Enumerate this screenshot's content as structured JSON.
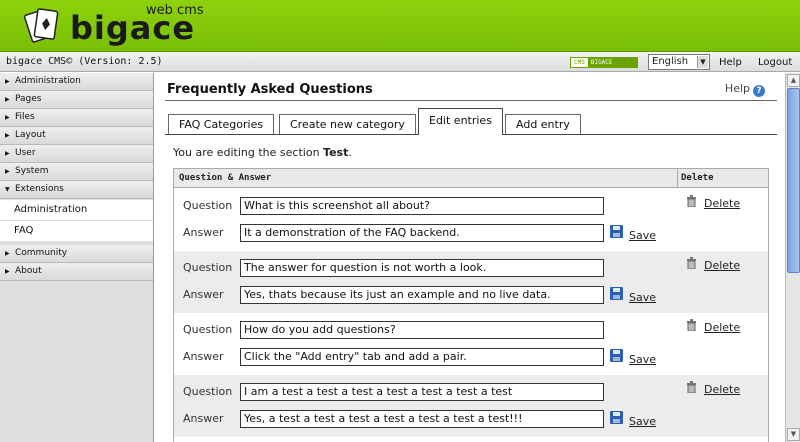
{
  "header": {
    "logo_text": "bigace",
    "logo_sub": "web cms"
  },
  "toolbar": {
    "version": "bigace CMS© (Version: 2.5)",
    "badge_left": "CMS",
    "badge_right": "BIGACE",
    "language": "English",
    "help": "Help",
    "logout": "Logout"
  },
  "sidebar": {
    "items": [
      {
        "label": "Administration"
      },
      {
        "label": "Pages"
      },
      {
        "label": "Files"
      },
      {
        "label": "Layout"
      },
      {
        "label": "User"
      },
      {
        "label": "System"
      },
      {
        "label": "Extensions"
      },
      {
        "label": "Community"
      },
      {
        "label": "About"
      }
    ],
    "sub_items": [
      {
        "label": "Administration"
      },
      {
        "label": "FAQ"
      }
    ]
  },
  "main": {
    "title": "Frequently Asked Questions",
    "help": "Help",
    "help_icon": "?",
    "tabs": [
      {
        "label": "FAQ Categories"
      },
      {
        "label": "Create new category"
      },
      {
        "label": "Edit entries"
      },
      {
        "label": "Add entry"
      }
    ],
    "editing_prefix": "You are editing the section",
    "editing_section": "Test",
    "editing_suffix": ".",
    "col_qa": "Question & Answer",
    "col_delete": "Delete",
    "question_label": "Question",
    "answer_label": "Answer",
    "save_label": "Save",
    "delete_label": "Delete",
    "entries": [
      {
        "question": "What is this screenshot all about?",
        "answer": "It a demonstration of the FAQ backend."
      },
      {
        "question": "The answer for question is not worth a look.",
        "answer": "Yes, thats because its just an example and no live data."
      },
      {
        "question": "How do you add questions?",
        "answer": "Click the \"Add entry\" tab and add a pair."
      },
      {
        "question": "I am a test a test a test a test a test a test a test",
        "answer": "Yes,  a test a test a test a test a test a test a test!!!"
      }
    ]
  },
  "colors": {
    "header_green": "#79bf06",
    "scroll_thumb": "#7ba3e0"
  }
}
